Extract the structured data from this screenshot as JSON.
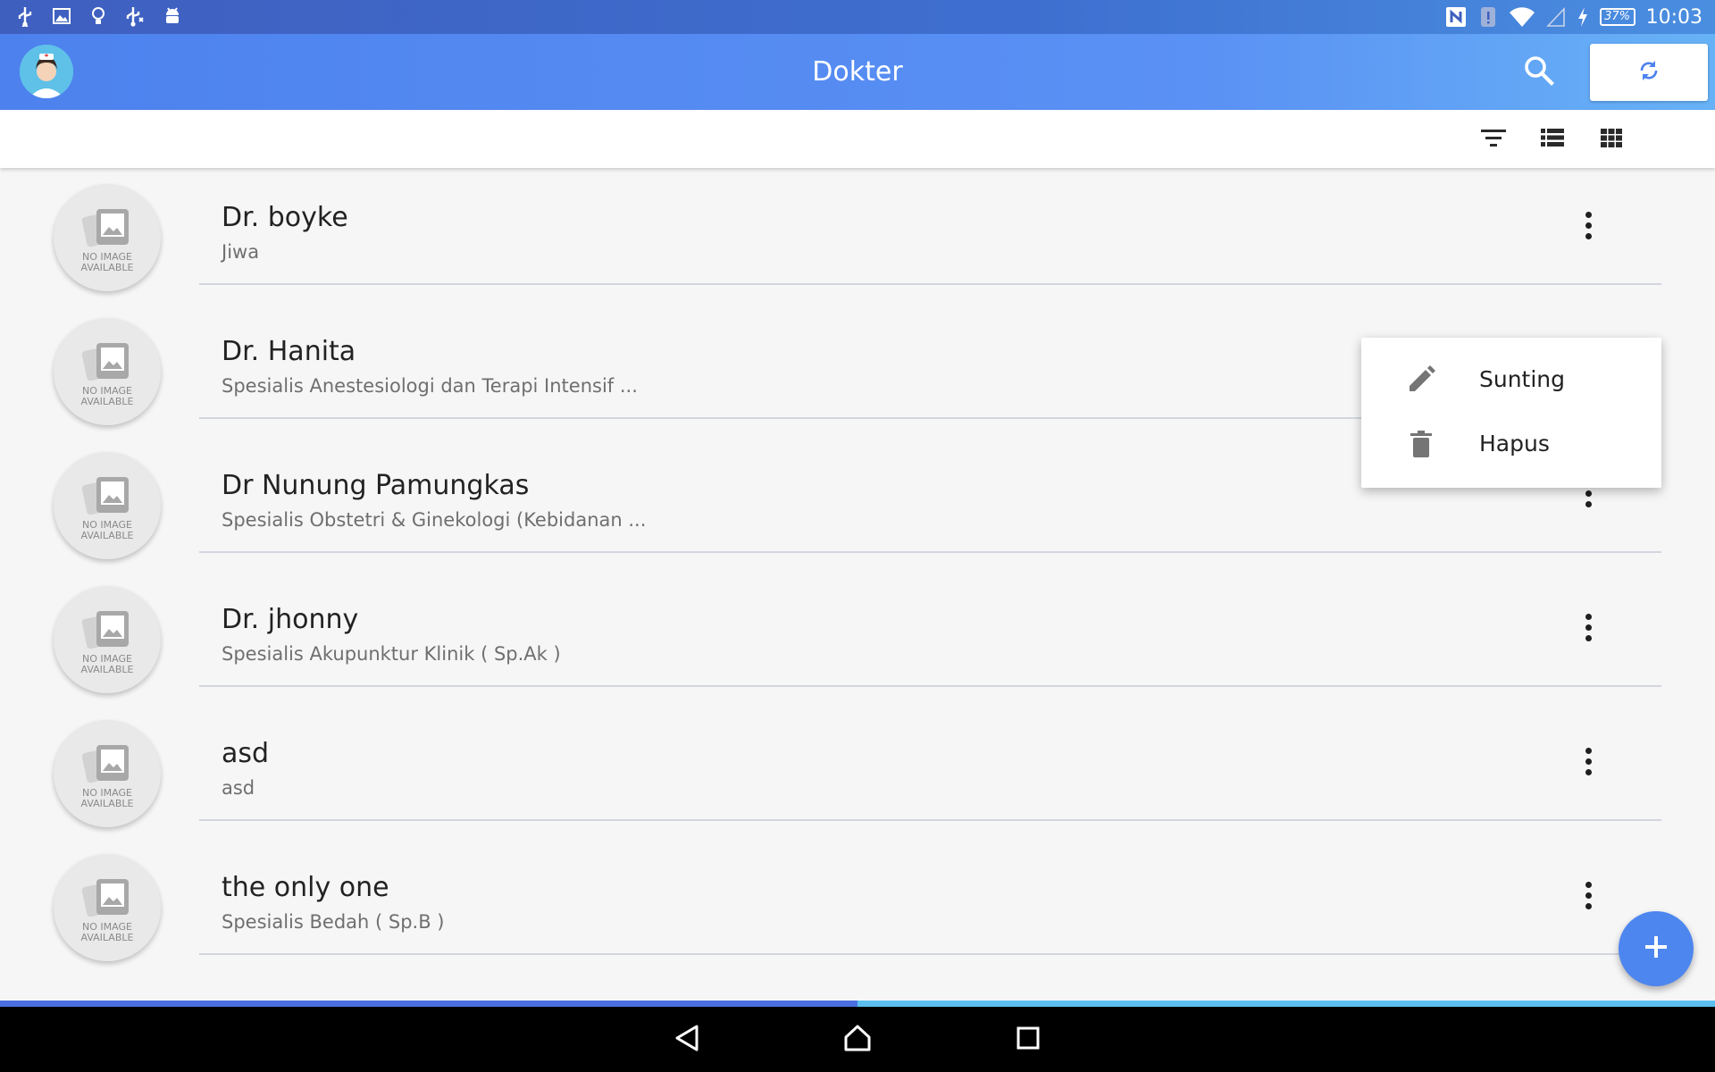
{
  "status_bar": {
    "time": "10:03",
    "battery": "37%",
    "left_icons": [
      "usb-icon",
      "image-icon",
      "bulb-icon",
      "usb-debug-icon",
      "android-icon"
    ],
    "right_icons": [
      "nfc-icon",
      "alert-icon",
      "wifi-icon",
      "signal-icon",
      "charging-icon"
    ]
  },
  "app_bar": {
    "title": "Dokter",
    "avatar": "nurse-avatar",
    "actions": [
      "search-icon",
      "sync-icon"
    ]
  },
  "toolbar": {
    "icons": [
      "filter-icon",
      "list-view-icon",
      "grid-view-icon"
    ]
  },
  "placeholder": {
    "line1": "NO IMAGE",
    "line2": "AVAILABLE"
  },
  "doctors": [
    {
      "name": "Dr. boyke",
      "specialty": "Jiwa"
    },
    {
      "name": "Dr. Hanita",
      "specialty": "Spesialis Anestesiologi dan Terapi Intensif ..."
    },
    {
      "name": "Dr Nunung Pamungkas",
      "specialty": "Spesialis Obstetri & Ginekologi (Kebidanan ..."
    },
    {
      "name": "Dr. jhonny",
      "specialty": "Spesialis Akupunktur Klinik ( Sp.Ak )"
    },
    {
      "name": "asd",
      "specialty": "asd"
    },
    {
      "name": "the only one",
      "specialty": "Spesialis Bedah ( Sp.B )"
    }
  ],
  "popup_menu": {
    "items": [
      {
        "label": "Sunting",
        "icon": "pencil-icon"
      },
      {
        "label": "Hapus",
        "icon": "trash-icon"
      }
    ]
  },
  "fab": {
    "icon": "plus-icon"
  },
  "loading_progress": 0.5,
  "colors": {
    "primary": "#4d82ee",
    "primary_light": "#67b2f6",
    "fab": "#4e86ef",
    "status_bar": "#3f5fbf"
  }
}
